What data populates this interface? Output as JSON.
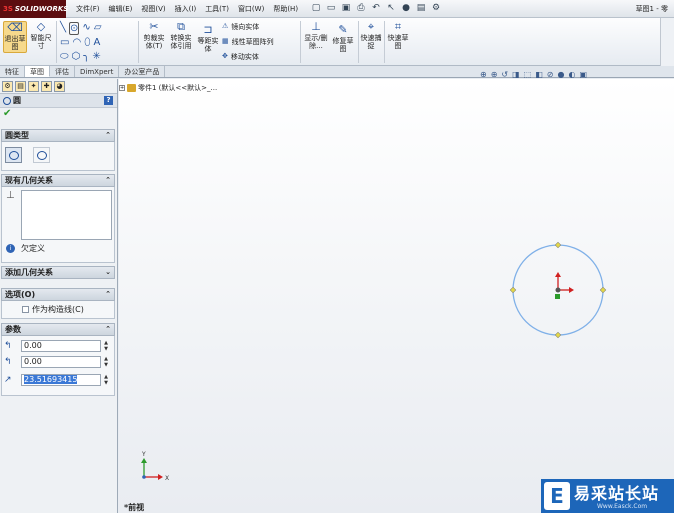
{
  "app": {
    "logo_text": "SOLIDWORKS",
    "window_title": "草图1 - 零"
  },
  "menu": [
    "文件(F)",
    "编辑(E)",
    "视图(V)",
    "插入(I)",
    "工具(T)",
    "窗口(W)",
    "帮助(H)"
  ],
  "ribbon": {
    "exit_sketch": "退出草图",
    "smart_dimension": "智能尺寸",
    "trim": "剪裁实体(T)",
    "convert": "转换实体引用",
    "offset": "等距实体",
    "mirror": "镜向实体",
    "linear_pattern": "线性草图阵列",
    "move": "移动实体",
    "display_delete": "显示/删除...",
    "repair": "修复草图",
    "quick_snaps": "快速捕捉",
    "rapid_sketch": "快速草图"
  },
  "tabs": [
    "特征",
    "草图",
    "评估",
    "DimXpert",
    "办公室产品"
  ],
  "active_tab": "草图",
  "feature_tree": {
    "part_label": "零件1 (默认<<默认>_..."
  },
  "property_manager": {
    "title": "圆",
    "groups": {
      "circle_type": "圆类型",
      "existing_relations": "现有几何关系",
      "add_relations": "添加几何关系",
      "options": "选项(O)",
      "parameters": "参数"
    },
    "status": "欠定义",
    "construction_label": "作为构造线(C)",
    "params": {
      "cx": "0.00",
      "cy": "0.00",
      "radius": "23.51693415"
    }
  },
  "view_label": "*前视",
  "triad": {
    "x": "X",
    "y": "Y"
  },
  "watermark": {
    "text": "易采站长站",
    "url": "Www.Easck.Com"
  },
  "sketch": {
    "circle_color": "#7fb0e8",
    "radius": 23.51693415
  }
}
